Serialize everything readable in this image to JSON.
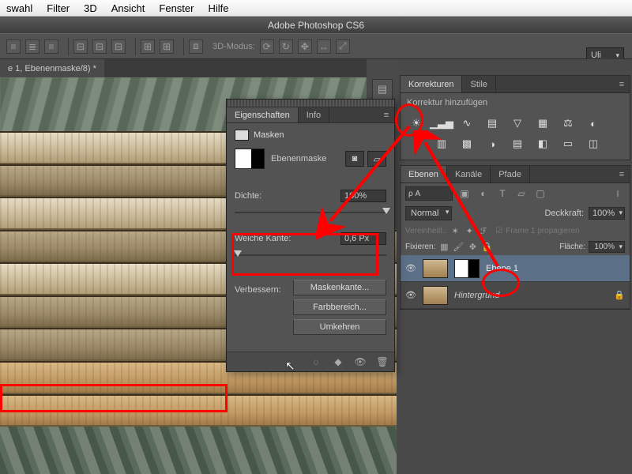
{
  "menubar": {
    "items": [
      "swahl",
      "Filter",
      "3D",
      "Ansicht",
      "Fenster",
      "Hilfe"
    ]
  },
  "app_title": "Adobe Photoshop CS6",
  "optionsbar": {
    "mode_label": "3D-Modus:"
  },
  "user_menu": "Uli",
  "doc_tab": "e 1, Ebenenmaske/8) *",
  "panels": {
    "korrekturen": {
      "tabs": [
        "Korrekturen",
        "Stile"
      ],
      "add_label": "Korrektur hinzufügen"
    },
    "ebenen": {
      "tabs": [
        "Ebenen",
        "Kanäle",
        "Pfade"
      ],
      "search_prefix": "ρ A",
      "blend_mode": "Normal",
      "deckkraft_label": "Deckkraft:",
      "deckkraft_value": "100%",
      "vereinheit_label": "Vereinheitl.:",
      "frame_prop": "Frame 1 propagieren",
      "fixieren_label": "Fixieren:",
      "flaeche_label": "Fläche:",
      "flaeche_value": "100%",
      "layers": [
        {
          "name": "Ebene 1",
          "has_mask": true,
          "selected": true,
          "locked": false
        },
        {
          "name": "Hintergrund",
          "has_mask": false,
          "selected": false,
          "locked": true
        }
      ]
    }
  },
  "properties": {
    "tabs": [
      "Eigenschaften",
      "Info"
    ],
    "section": "Masken",
    "type_label": "Ebenenmaske",
    "dichte_label": "Dichte:",
    "dichte_value": "100%",
    "weiche_label": "Weiche Kante:",
    "weiche_value": "0,6 Px",
    "verbessern_label": "Verbessern:",
    "btn_maskenkante": "Maskenkante...",
    "btn_farbbereich": "Farbbereich...",
    "btn_umkehren": "Umkehren"
  }
}
